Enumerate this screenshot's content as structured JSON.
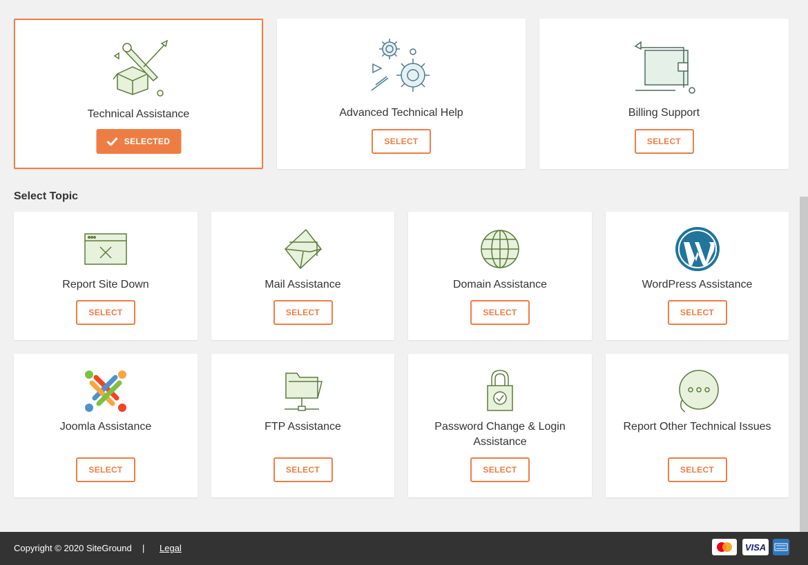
{
  "top_cards": [
    {
      "label": "Technical Assistance",
      "button": "SELECTED",
      "selected": true,
      "icon": "tools-box-icon"
    },
    {
      "label": "Advanced Technical Help",
      "button": "SELECT",
      "selected": false,
      "icon": "gears-icon"
    },
    {
      "label": "Billing Support",
      "button": "SELECT",
      "selected": false,
      "icon": "wallet-icon"
    }
  ],
  "section_title": "Select Topic",
  "topics": [
    {
      "label": "Report Site Down",
      "button": "SELECT",
      "icon": "browser-error-icon"
    },
    {
      "label": "Mail Assistance",
      "button": "SELECT",
      "icon": "envelope-icon"
    },
    {
      "label": "Domain Assistance",
      "button": "SELECT",
      "icon": "globe-icon"
    },
    {
      "label": "WordPress Assistance",
      "button": "SELECT",
      "icon": "wordpress-icon"
    },
    {
      "label": "Joomla Assistance",
      "button": "SELECT",
      "icon": "joomla-icon"
    },
    {
      "label": "FTP Assistance",
      "button": "SELECT",
      "icon": "folder-network-icon"
    },
    {
      "label": "Password Change & Login Assistance",
      "button": "SELECT",
      "icon": "padlock-icon"
    },
    {
      "label": "Report Other Technical Issues",
      "button": "SELECT",
      "icon": "chat-dots-icon"
    }
  ],
  "footer": {
    "copyright": "Copyright © 2020 SiteGround",
    "separator": "|",
    "legal": "Legal",
    "payments": [
      "mastercard-icon",
      "VISA",
      "amex-icon"
    ]
  },
  "colors": {
    "accent": "#ee7d44",
    "icon_stroke": "#5b7a3a",
    "icon_fill": "#e8f1dc",
    "footer_bg": "#333333"
  }
}
